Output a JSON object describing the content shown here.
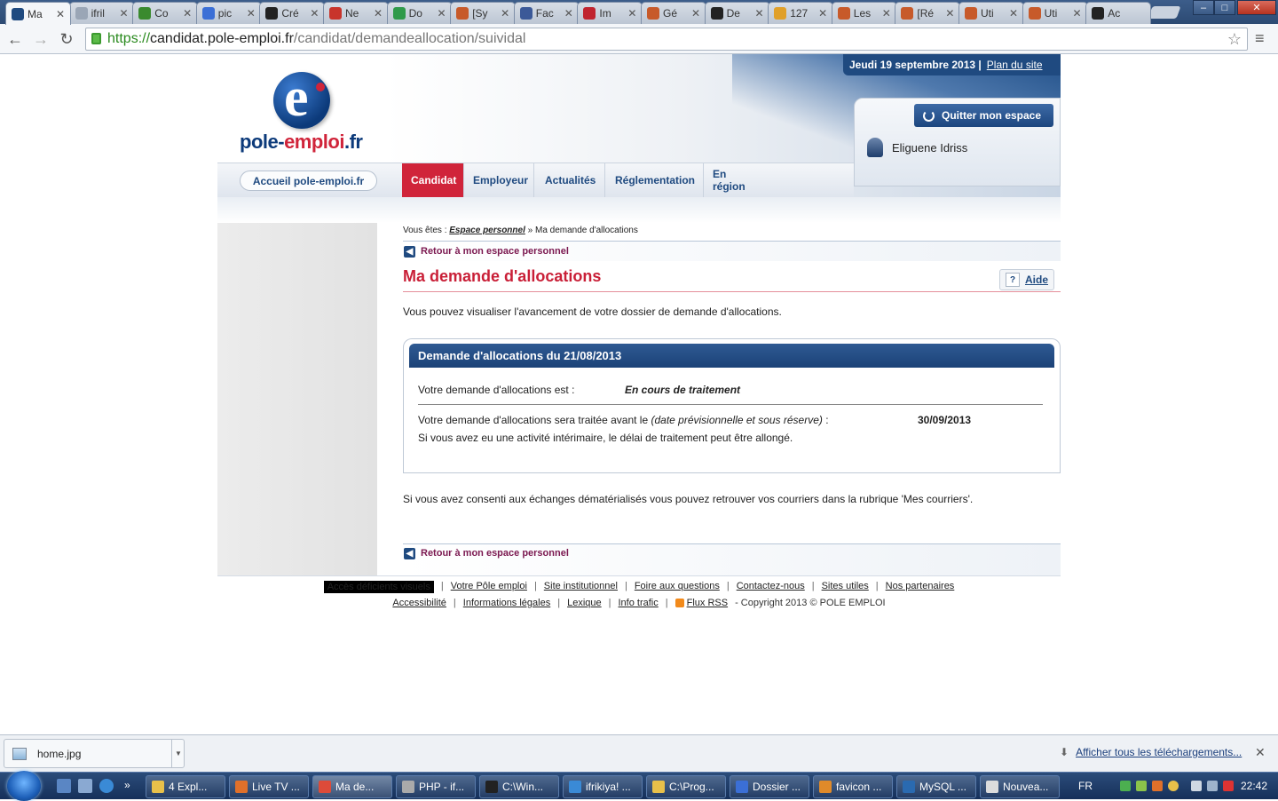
{
  "browser": {
    "tabs": [
      {
        "title": "Ma",
        "fav": "pole-emploi-icon",
        "color": "#1f4a80",
        "active": true
      },
      {
        "title": "ifril",
        "fav": "page-icon",
        "color": "#9aa6b6"
      },
      {
        "title": "Co",
        "fav": "leaf-icon",
        "color": "#3a8a2e"
      },
      {
        "title": "pic",
        "fav": "google-icon",
        "color": "#3b6fd6"
      },
      {
        "title": "Cré",
        "fav": "symfony-icon",
        "color": "#222"
      },
      {
        "title": "Ne",
        "fav": "gmail-icon",
        "color": "#c8342b"
      },
      {
        "title": "Do",
        "fav": "drive-icon",
        "color": "#2f9a4b"
      },
      {
        "title": "[Sy",
        "fav": "forum-icon",
        "color": "#c75a2a"
      },
      {
        "title": "Fac",
        "fav": "facebook-icon",
        "color": "#3b5998"
      },
      {
        "title": "Im",
        "fav": "hash-icon",
        "color": "#c0242f"
      },
      {
        "title": "Gé",
        "fav": "forum-icon",
        "color": "#c75a2a"
      },
      {
        "title": "De",
        "fav": "terminal-icon",
        "color": "#222"
      },
      {
        "title": "127",
        "fav": "pma-icon",
        "color": "#e0a02a"
      },
      {
        "title": "Les",
        "fav": "forum-icon",
        "color": "#c75a2a"
      },
      {
        "title": "[Ré",
        "fav": "forum-icon",
        "color": "#c75a2a"
      },
      {
        "title": "Uti",
        "fav": "forum-icon",
        "color": "#c75a2a"
      },
      {
        "title": "Uti",
        "fav": "forum-icon",
        "color": "#c75a2a"
      },
      {
        "title": "Ac",
        "fav": "plus-icon",
        "color": "#222"
      }
    ],
    "url_scheme": "https://",
    "url_host": "candidat.pole-emploi.fr",
    "url_path": "/candidat/demandeallocation/suividal"
  },
  "header": {
    "logo_text_a": "pole-",
    "logo_text_b": "emploi",
    "logo_text_c": ".fr",
    "date": "Jeudi 19 septembre 2013",
    "date_sep": "|",
    "sitemap": "Plan du site",
    "quit_button": "Quitter mon espace",
    "user_name": "Eliguene Idriss",
    "home_link": "Accueil pole-emploi.fr",
    "nav": [
      "Candidat",
      "Employeur",
      "Actualités",
      "Réglementation",
      "En région"
    ]
  },
  "breadcrumb": {
    "prefix": "Vous êtes :",
    "link": "Espace personnel",
    "sep": "»",
    "current": "Ma demande d'allocations"
  },
  "main": {
    "back_link": "Retour à mon espace personnel",
    "title": "Ma demande d'allocations",
    "help": "Aide",
    "help_mark": "?",
    "intro": "Vous pouvez visualiser l'avancement de votre dossier de demande d'allocations.",
    "box_title": "Demande d'allocations du 21/08/2013",
    "status_label": "Votre demande d'allocations est :",
    "status_value": "En cours de traitement",
    "deadline_label": "Votre demande d'allocations sera traitée avant le",
    "deadline_note": "(date prévisionnelle et sous réserve)",
    "deadline_colon": ":",
    "deadline_value": "30/09/2013",
    "interim_note": "Si vous avez eu une activité intérimaire, le délai de traitement peut être allongé.",
    "courriers_note": "Si vous avez consenti aux échanges dématérialisés vous pouvez retrouver vos courriers dans la rubrique 'Mes courriers'."
  },
  "footer": {
    "line1": [
      "Accès déficients visuels",
      "Votre Pôle emploi",
      "Site institutionnel",
      "Foire aux questions",
      "Contactez-nous",
      "Sites utiles",
      "Nos partenaires"
    ],
    "line2": [
      "Accessibilité",
      "Informations légales",
      "Lexique",
      "Info trafic",
      "Flux RSS"
    ],
    "copyright": "- Copyright 2013 © POLE EMPLOI"
  },
  "downloads": {
    "file": "home.jpg",
    "show_all": "Afficher tous les téléchargements..."
  },
  "taskbar": {
    "items": [
      {
        "label": "4 Expl...",
        "color": "#e8c04a"
      },
      {
        "label": "Live TV ...",
        "color": "#e0702a"
      },
      {
        "label": "Ma de...",
        "color": "#dd4b39",
        "active": true
      },
      {
        "label": "PHP - if...",
        "color": "#aaa"
      },
      {
        "label": "C:\\Win...",
        "color": "#222"
      },
      {
        "label": "ifrikiya! ...",
        "color": "#3a8ad6"
      },
      {
        "label": "C:\\Prog...",
        "color": "#e8c04a"
      },
      {
        "label": "Dossier ...",
        "color": "#3b6fd6"
      },
      {
        "label": "favicon ...",
        "color": "#e08a2a"
      },
      {
        "label": "MySQL ...",
        "color": "#2a6ab0"
      },
      {
        "label": "Nouvea...",
        "color": "#dcdcdc"
      }
    ],
    "lang": "FR",
    "time": "22:42"
  }
}
